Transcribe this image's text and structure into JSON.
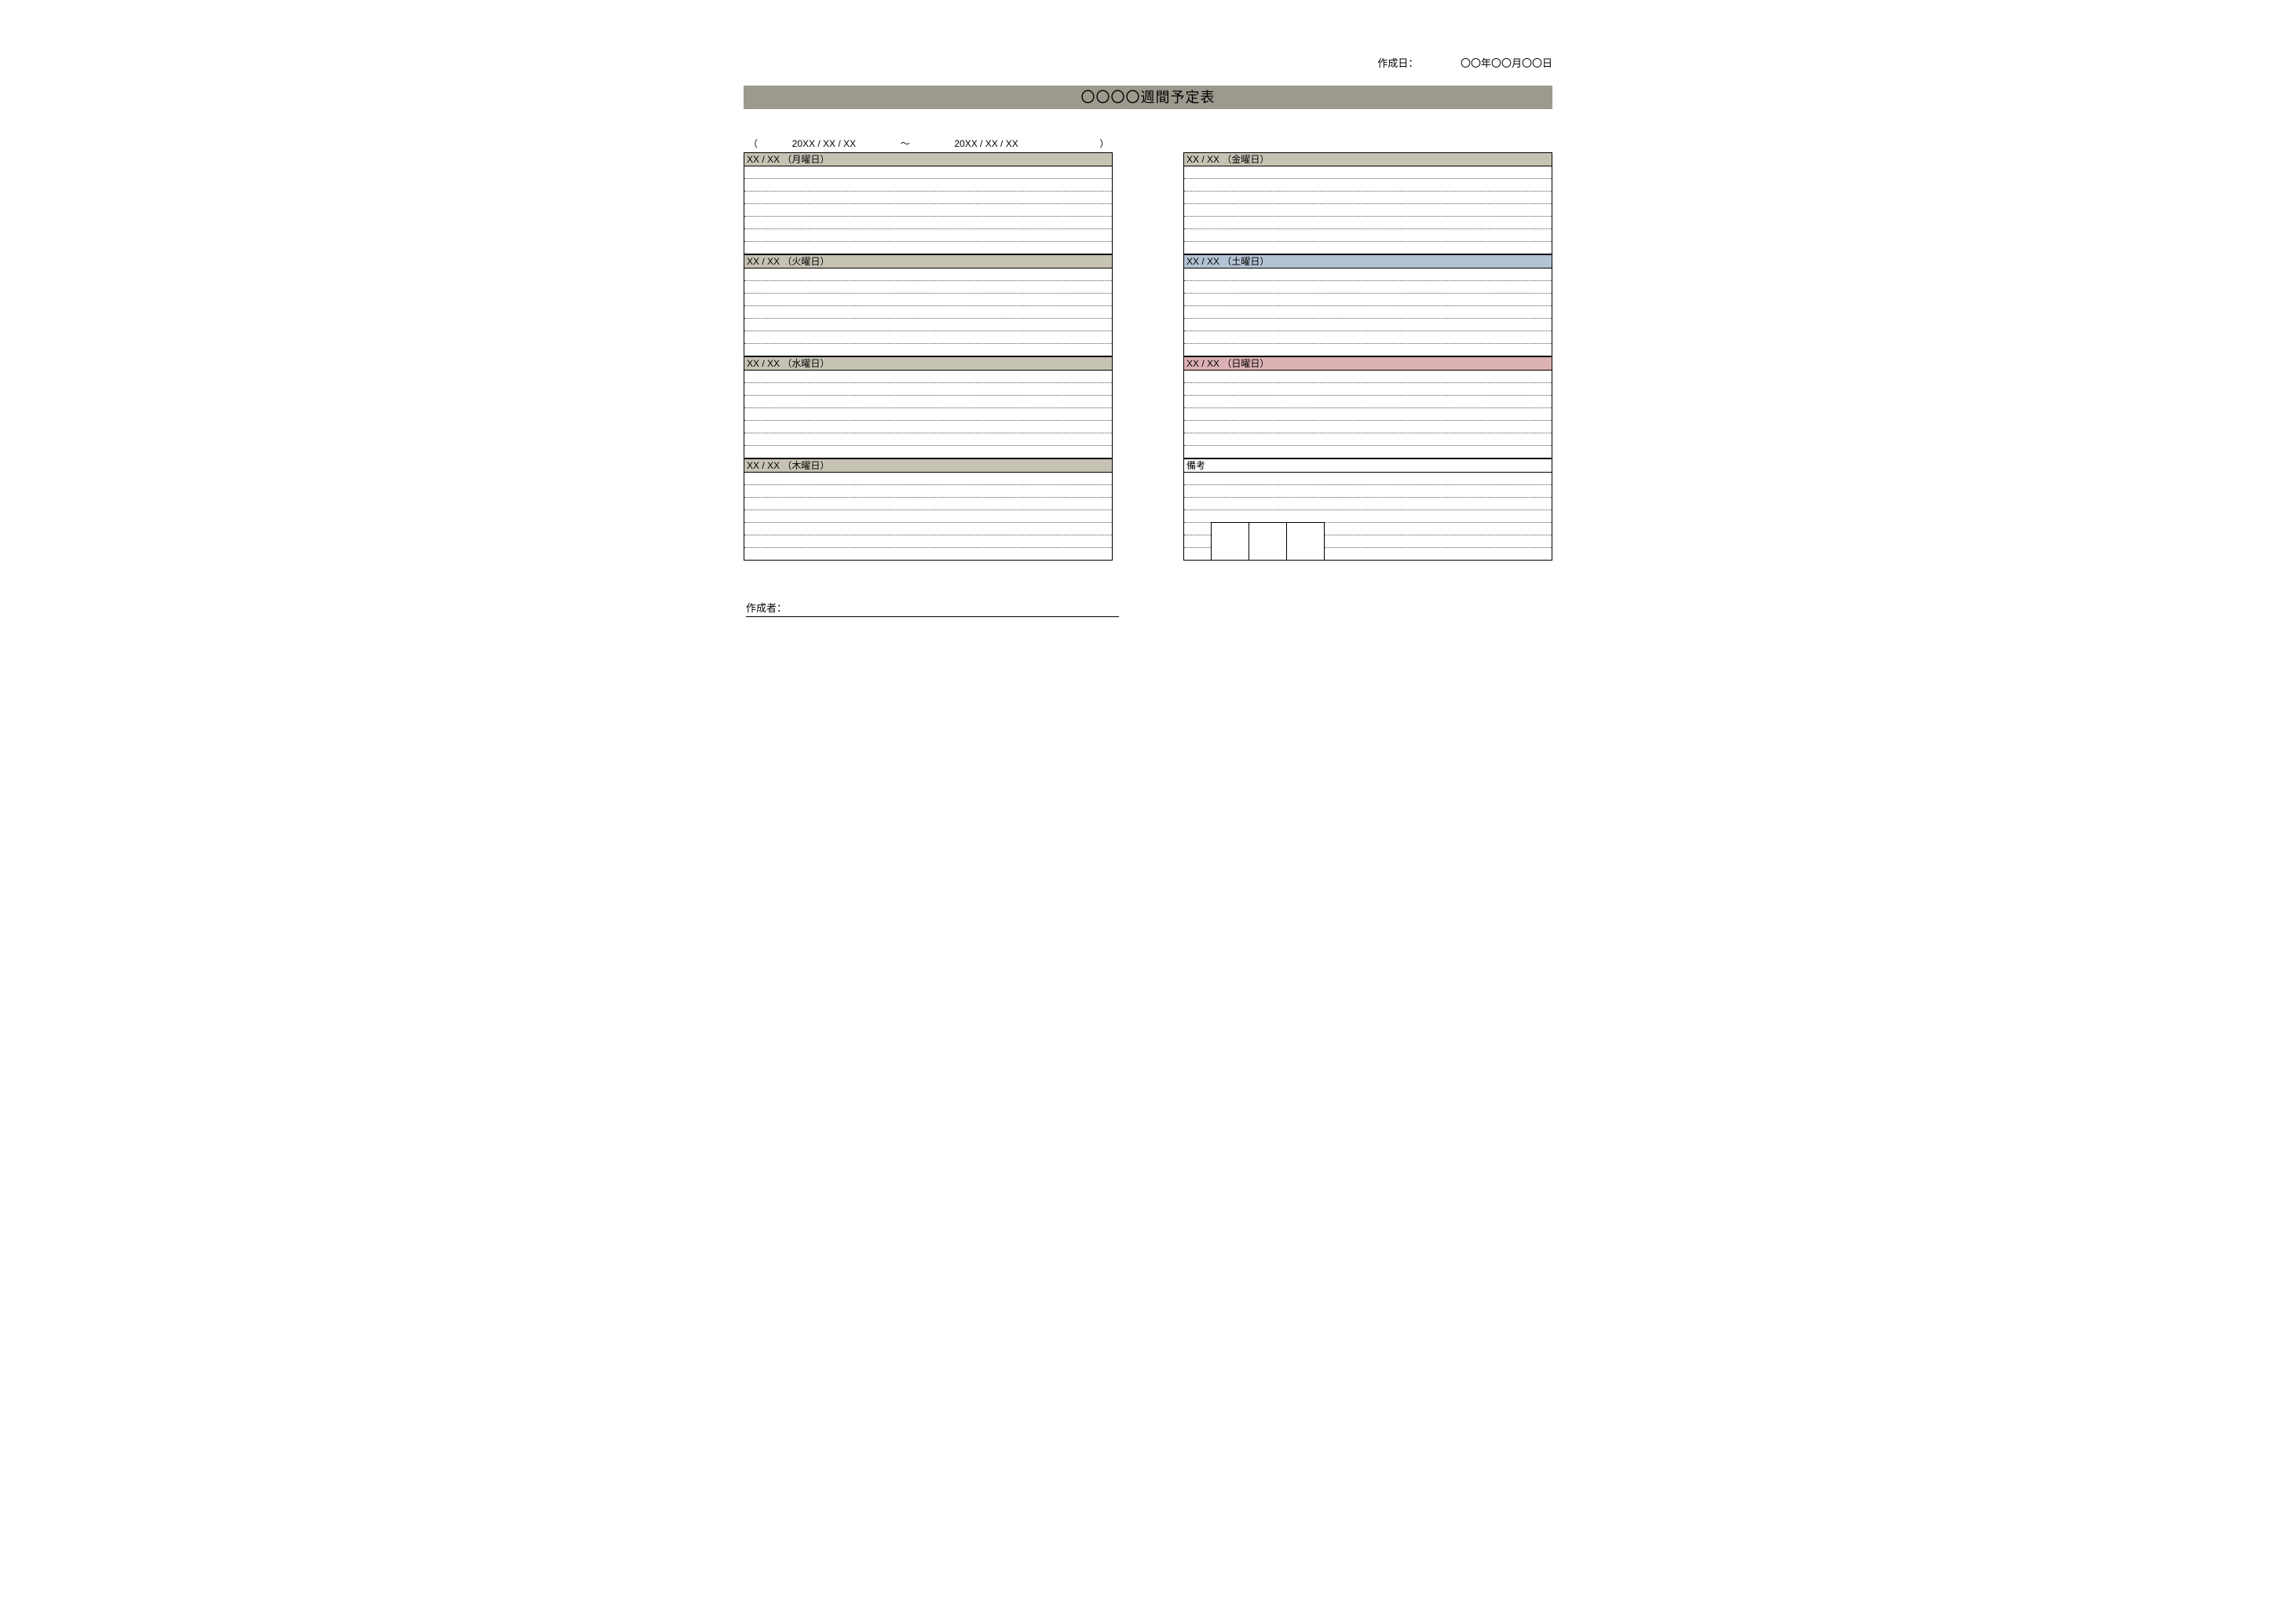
{
  "meta": {
    "created_label": "作成日：",
    "created_value": "〇〇年〇〇月〇〇日"
  },
  "title": "〇〇〇〇週間予定表",
  "range": {
    "open": "（",
    "start": "20XX / XX / XX",
    "tilde": "～",
    "end": "20XX / XX / XX",
    "close": "）"
  },
  "left_days": [
    {
      "label": "XX / XX （月曜日）",
      "color": "c-beige",
      "lines": 7
    },
    {
      "label": "XX / XX （火曜日）",
      "color": "c-beige",
      "lines": 7
    },
    {
      "label": "XX / XX （水曜日）",
      "color": "c-beige",
      "lines": 7
    },
    {
      "label": "XX / XX （木曜日）",
      "color": "c-beige",
      "lines": 7
    }
  ],
  "right_days": [
    {
      "label": "XX / XX （金曜日）",
      "color": "c-beige",
      "lines": 7
    },
    {
      "label": "XX / XX （土曜日）",
      "color": "c-blue",
      "lines": 7
    },
    {
      "label": "XX / XX （日曜日）",
      "color": "c-pink",
      "lines": 7
    }
  ],
  "notes": {
    "label": "備考",
    "pre_lines": 4,
    "stamp_count": 3
  },
  "author_label": "作成者："
}
